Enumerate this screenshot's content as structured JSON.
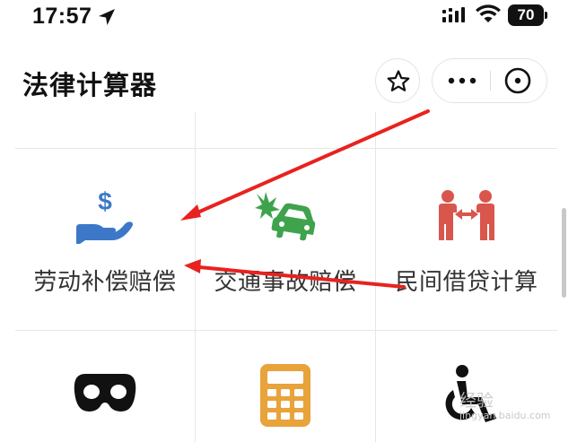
{
  "status_bar": {
    "time": "17:57",
    "battery": "70",
    "icons": [
      "location-arrow-icon",
      "signal-icon",
      "wifi-icon",
      "battery-icon"
    ]
  },
  "header": {
    "title": "法律计算器",
    "buttons": [
      "star-icon",
      "more-icon",
      "close-icon"
    ]
  },
  "grid": {
    "items": [
      {
        "label": "劳动补偿赔偿",
        "icon": "hand-money-icon",
        "color": "#3d78c8"
      },
      {
        "label": "交通事故赔偿",
        "icon": "car-crash-icon",
        "color": "#3fa34d"
      },
      {
        "label": "民间借贷计算",
        "icon": "people-lending-icon",
        "color": "#d9564c"
      },
      {
        "label": "",
        "icon": "mask-icon",
        "color": "#111111"
      },
      {
        "label": "",
        "icon": "calculator-icon",
        "color": "#e8a33a"
      },
      {
        "label": "",
        "icon": "wheelchair-icon",
        "color": "#111111"
      }
    ]
  },
  "annotations": {
    "arrow_color": "#e8221f"
  },
  "watermark": {
    "text": "经验",
    "url": "jingyan.baidu.com"
  }
}
